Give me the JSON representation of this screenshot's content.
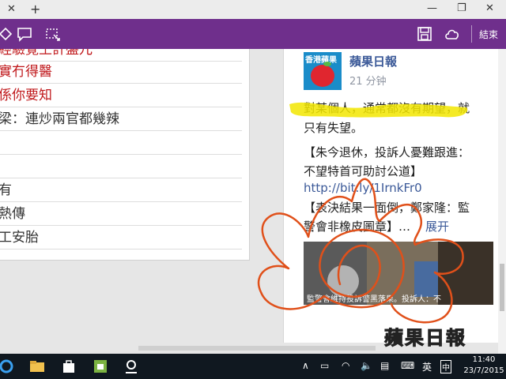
{
  "titlebar": {
    "close_glyph": "✕",
    "new_tab_glyph": "+",
    "minimize_glyph": "—",
    "restore_glyph": "❐",
    "close_window_glyph": "✕"
  },
  "notebar": {
    "finish_label": "結束",
    "color": "#6f2f8c"
  },
  "left_list": [
    "經驗覺王計盤兀",
    "實冇得醫",
    "係你要知",
    "梁：連炒兩官都幾辣",
    "",
    "",
    "有",
    "熱傳",
    "工安胎"
  ],
  "post": {
    "page_name": "蘋果日報",
    "time": "21 分钟",
    "avatar_text": "香港蘋果",
    "line1": "對某個人，通常都沒有期望，就",
    "line2": "只有失望。",
    "line3": "【朱今退休，投訴人憂難跟進：",
    "line4": "不望特首可助討公道】",
    "link": "http://bit.ly/1IrnkFr0",
    "line6": "【表決結果一面倒，鄭家隆：監",
    "line7_pre": "警會非橡皮圖章】…",
    "expand": "展开",
    "photo_caption": "監警會維持投訴警黑落果。投訴人：不"
  },
  "watermark": "蘋果日報",
  "taskbar": {
    "ime": "英",
    "ime2": "中",
    "time": "11:40",
    "date": "23/7/2015"
  },
  "colors": {
    "highlight": "#f2e600",
    "pen": "#e0501a",
    "link": "#3b5998",
    "red_text": "#c0191c"
  }
}
